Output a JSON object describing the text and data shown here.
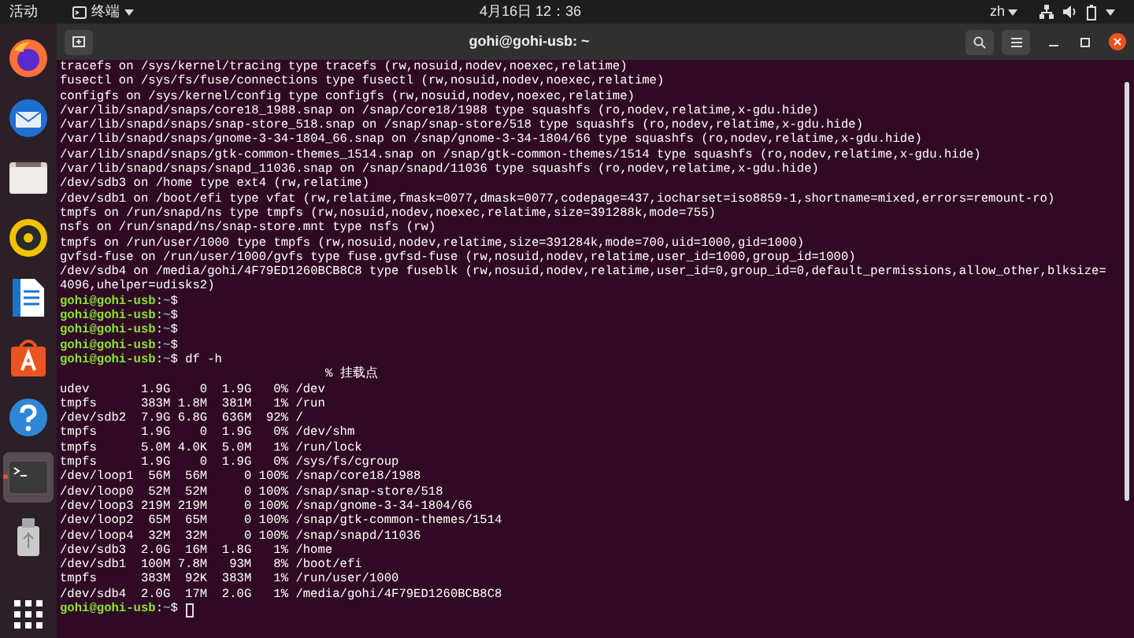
{
  "top_bar": {
    "activities": "活动",
    "app_menu": "终端",
    "clock": "4月16日 12：36",
    "input_method": "zh"
  },
  "dock": {
    "items": [
      {
        "kind": "browser",
        "running": false,
        "selected": false
      },
      {
        "kind": "mail",
        "running": false,
        "selected": false
      },
      {
        "kind": "files",
        "running": false,
        "selected": false
      },
      {
        "kind": "music",
        "running": false,
        "selected": false
      },
      {
        "kind": "document",
        "running": false,
        "selected": false
      },
      {
        "kind": "store",
        "running": false,
        "selected": false
      },
      {
        "kind": "help",
        "running": false,
        "selected": false
      },
      {
        "kind": "terminal",
        "running": true,
        "selected": true
      },
      {
        "kind": "drive",
        "running": false,
        "selected": false
      }
    ]
  },
  "window": {
    "title": "gohi@gohi-usb: ~"
  },
  "terminal": {
    "lines": [
      {
        "kind": "text",
        "text": "tracefs on /sys/kernel/tracing type tracefs (rw,nosuid,nodev,noexec,relatime)"
      },
      {
        "kind": "text",
        "text": "fusectl on /sys/fs/fuse/connections type fusectl (rw,nosuid,nodev,noexec,relatime)"
      },
      {
        "kind": "text",
        "text": "configfs on /sys/kernel/config type configfs (rw,nosuid,nodev,noexec,relatime)"
      },
      {
        "kind": "text",
        "text": "/var/lib/snapd/snaps/core18_1988.snap on /snap/core18/1988 type squashfs (ro,nodev,relatime,x-gdu.hide)"
      },
      {
        "kind": "text",
        "text": "/var/lib/snapd/snaps/snap-store_518.snap on /snap/snap-store/518 type squashfs (ro,nodev,relatime,x-gdu.hide)"
      },
      {
        "kind": "text",
        "text": "/var/lib/snapd/snaps/gnome-3-34-1804_66.snap on /snap/gnome-3-34-1804/66 type squashfs (ro,nodev,relatime,x-gdu.hide)"
      },
      {
        "kind": "text",
        "text": "/var/lib/snapd/snaps/gtk-common-themes_1514.snap on /snap/gtk-common-themes/1514 type squashfs (ro,nodev,relatime,x-gdu.hide)"
      },
      {
        "kind": "text",
        "text": "/var/lib/snapd/snaps/snapd_11036.snap on /snap/snapd/11036 type squashfs (ro,nodev,relatime,x-gdu.hide)"
      },
      {
        "kind": "text",
        "text": "/dev/sdb3 on /home type ext4 (rw,relatime)"
      },
      {
        "kind": "text",
        "text": "/dev/sdb1 on /boot/efi type vfat (rw,relatime,fmask=0077,dmask=0077,codepage=437,iocharset=iso8859-1,shortname=mixed,errors=remount-ro)"
      },
      {
        "kind": "text",
        "text": "tmpfs on /run/snapd/ns type tmpfs (rw,nosuid,nodev,noexec,relatime,size=391288k,mode=755)"
      },
      {
        "kind": "text",
        "text": "nsfs on /run/snapd/ns/snap-store.mnt type nsfs (rw)"
      },
      {
        "kind": "text",
        "text": "tmpfs on /run/user/1000 type tmpfs (rw,nosuid,nodev,relatime,size=391284k,mode=700,uid=1000,gid=1000)"
      },
      {
        "kind": "text",
        "text": "gvfsd-fuse on /run/user/1000/gvfs type fuse.gvfsd-fuse (rw,nosuid,nodev,relatime,user_id=1000,group_id=1000)"
      },
      {
        "kind": "text",
        "text": "/dev/sdb4 on /media/gohi/4F79ED1260BCB8C8 type fuseblk (rw,nosuid,nodev,relatime,user_id=0,group_id=0,default_permissions,allow_other,blksize="
      },
      {
        "kind": "text",
        "text": "4096,uhelper=udisks2)"
      },
      {
        "kind": "prompt",
        "user": "gohi@gohi-usb",
        "sep": ":",
        "path": "~",
        "symbol": "$",
        "cursor": false
      },
      {
        "kind": "prompt",
        "user": "gohi@gohi-usb",
        "sep": ":",
        "path": "~",
        "symbol": "$",
        "cursor": false
      },
      {
        "kind": "prompt",
        "user": "gohi@gohi-usb",
        "sep": ":",
        "path": "~",
        "symbol": "$",
        "cursor": false
      },
      {
        "kind": "prompt",
        "user": "gohi@gohi-usb",
        "sep": ":",
        "path": "~",
        "symbol": "$",
        "cursor": false
      },
      {
        "kind": "prompt",
        "user": "gohi@gohi-usb",
        "sep": ":",
        "path": "~",
        "symbol": "$",
        "command": "df -h",
        "cursor": false
      },
      {
        "kind": "df-header",
        "text": "% 挂载点"
      },
      {
        "kind": "df-row",
        "cells": [
          "udev",
          "1.9G",
          "0",
          "1.9G",
          "0%",
          "/dev"
        ]
      },
      {
        "kind": "df-row",
        "cells": [
          "tmpfs",
          "383M",
          "1.8M",
          "381M",
          "1%",
          "/run"
        ]
      },
      {
        "kind": "df-row",
        "cells": [
          "/dev/sdb2",
          "7.9G",
          "6.8G",
          "636M",
          "92%",
          "/"
        ]
      },
      {
        "kind": "df-row",
        "cells": [
          "tmpfs",
          "1.9G",
          "0",
          "1.9G",
          "0%",
          "/dev/shm"
        ]
      },
      {
        "kind": "df-row",
        "cells": [
          "tmpfs",
          "5.0M",
          "4.0K",
          "5.0M",
          "1%",
          "/run/lock"
        ]
      },
      {
        "kind": "df-row",
        "cells": [
          "tmpfs",
          "1.9G",
          "0",
          "1.9G",
          "0%",
          "/sys/fs/cgroup"
        ]
      },
      {
        "kind": "df-row",
        "cells": [
          "/dev/loop1",
          "56M",
          "56M",
          "0",
          "100%",
          "/snap/core18/1988"
        ]
      },
      {
        "kind": "df-row",
        "cells": [
          "/dev/loop0",
          "52M",
          "52M",
          "0",
          "100%",
          "/snap/snap-store/518"
        ]
      },
      {
        "kind": "df-row",
        "cells": [
          "/dev/loop3",
          "219M",
          "219M",
          "0",
          "100%",
          "/snap/gnome-3-34-1804/66"
        ]
      },
      {
        "kind": "df-row",
        "cells": [
          "/dev/loop2",
          "65M",
          "65M",
          "0",
          "100%",
          "/snap/gtk-common-themes/1514"
        ]
      },
      {
        "kind": "df-row",
        "cells": [
          "/dev/loop4",
          "32M",
          "32M",
          "0",
          "100%",
          "/snap/snapd/11036"
        ]
      },
      {
        "kind": "df-row",
        "cells": [
          "/dev/sdb3",
          "2.0G",
          "16M",
          "1.8G",
          "1%",
          "/home"
        ]
      },
      {
        "kind": "df-row",
        "cells": [
          "/dev/sdb1",
          "100M",
          "7.8M",
          "93M",
          "8%",
          "/boot/efi"
        ]
      },
      {
        "kind": "df-row",
        "cells": [
          "tmpfs",
          "383M",
          "92K",
          "383M",
          "1%",
          "/run/user/1000"
        ]
      },
      {
        "kind": "df-row",
        "cells": [
          "/dev/sdb4",
          "2.0G",
          "17M",
          "2.0G",
          "1%",
          "/media/gohi/4F79ED1260BCB8C8"
        ]
      },
      {
        "kind": "prompt",
        "user": "gohi@gohi-usb",
        "sep": ":",
        "path": "~",
        "symbol": "$",
        "cursor": true
      }
    ]
  }
}
